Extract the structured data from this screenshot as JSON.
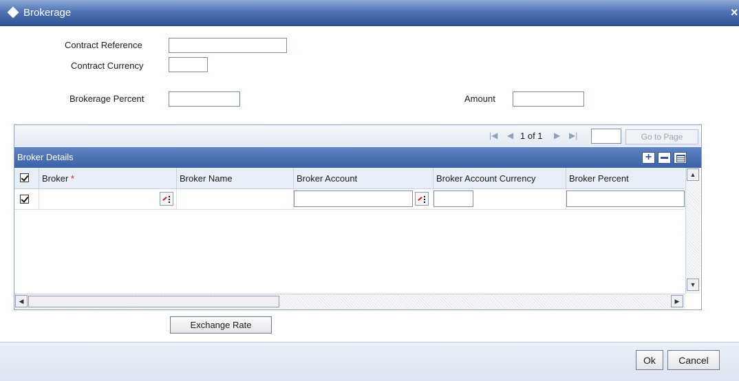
{
  "window": {
    "title": "Brokerage",
    "close_glyph": "×"
  },
  "form": {
    "contract_reference": {
      "label": "Contract Reference",
      "value": ""
    },
    "contract_currency": {
      "label": "Contract Currency",
      "value": ""
    },
    "brokerage_percent": {
      "label": "Brokerage Percent",
      "value": ""
    },
    "amount": {
      "label": "Amount",
      "value": ""
    }
  },
  "grid": {
    "pager": {
      "first_icon": "first-page-icon",
      "prev_icon": "previous-page-icon",
      "next_icon": "next-page-icon",
      "last_icon": "last-page-icon",
      "page_text": "1 of 1",
      "go_to_label": "Go to Page",
      "page_input": ""
    },
    "section_title": "Broker Details",
    "columns": [
      "Broker",
      "Broker Name",
      "Broker Account",
      "Broker Account Currency",
      "Broker Percent"
    ],
    "required_marker": "*",
    "rows": [
      {
        "selected": true,
        "broker": "",
        "broker_name": "",
        "broker_account": "",
        "broker_account_currency": "",
        "broker_percent": ""
      }
    ]
  },
  "buttons": {
    "exchange_rate": "Exchange Rate",
    "ok": "Ok",
    "cancel": "Cancel"
  },
  "colors": {
    "title_bar": "#2f5597",
    "section_bar": "#3a62a6",
    "required": "#d21f1f"
  }
}
